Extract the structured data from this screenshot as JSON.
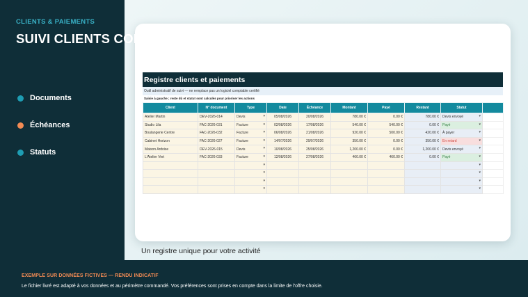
{
  "eyebrow": "CLIENTS & PAIEMENTS",
  "headline": "SUIVI CLIENTS COMPLET",
  "features": [
    {
      "label": "Documents",
      "color": "#1e9db3"
    },
    {
      "label": "Échéances",
      "color": "#f28b54"
    },
    {
      "label": "Statuts",
      "color": "#1e9db3"
    }
  ],
  "sheet": {
    "title": "Registre clients et paiements",
    "note": "Outil administratif de suivi — ne remplace pas un logiciel comptable certifié",
    "hint": "Saisie à gauche ; reste dû et statut sont calculés pour prioriser les actions",
    "columns": [
      "Client",
      "N° document",
      "Type",
      "Date",
      "Échéance",
      "Montant",
      "Payé",
      "Restant",
      "Statut"
    ],
    "rows": [
      {
        "client": "Atelier Martin",
        "doc": "DEV-2026-014",
        "type": "Devis",
        "date": "05/08/2026",
        "due": "20/08/2026",
        "amount": "780.00 €",
        "paid": "0.00 €",
        "rest": "780.00 €",
        "status": "Devis envoyé",
        "status_kind": "neutral"
      },
      {
        "client": "Studio Lila",
        "doc": "FAC-2026-031",
        "type": "Facture",
        "date": "02/08/2026",
        "due": "17/08/2026",
        "amount": "540.00 €",
        "paid": "540.00 €",
        "rest": "0.00 €",
        "status": "Payé",
        "status_kind": "paye"
      },
      {
        "client": "Boulangerie Centre",
        "doc": "FAC-2026-032",
        "type": "Facture",
        "date": "06/08/2026",
        "due": "21/08/2026",
        "amount": "920.00 €",
        "paid": "500.00 €",
        "rest": "420.00 €",
        "status": "À payer",
        "status_kind": "neutral"
      },
      {
        "client": "Cabinet Horizon",
        "doc": "FAC-2026-027",
        "type": "Facture",
        "date": "14/07/2026",
        "due": "29/07/2026",
        "amount": "350.00 €",
        "paid": "0.00 €",
        "rest": "350.00 €",
        "status": "En retard",
        "status_kind": "retard"
      },
      {
        "client": "Maison Ardoise",
        "doc": "DEV-2026-015",
        "type": "Devis",
        "date": "10/08/2026",
        "due": "25/08/2026",
        "amount": "1,200.00 €",
        "paid": "0.00 €",
        "rest": "1,200.00 €",
        "status": "Devis envoyé",
        "status_kind": "neutral"
      },
      {
        "client": "L'Atelier Vert",
        "doc": "FAC-2026-033",
        "type": "Facture",
        "date": "12/08/2026",
        "due": "27/08/2026",
        "amount": "460.00 €",
        "paid": "460.00 €",
        "rest": "0.00 €",
        "status": "Payé",
        "status_kind": "paye"
      }
    ],
    "empty_rows": 4
  },
  "caption": "Un registre unique pour votre activité",
  "footer": {
    "title": "EXEMPLE SUR DONNÉES FICTIVES — RENDU INDICATIF",
    "text": "Le fichier livré est adapté à vos données et au périmètre commandé. Vos préférences sont prises en compte dans la limite de l'offre choisie."
  }
}
